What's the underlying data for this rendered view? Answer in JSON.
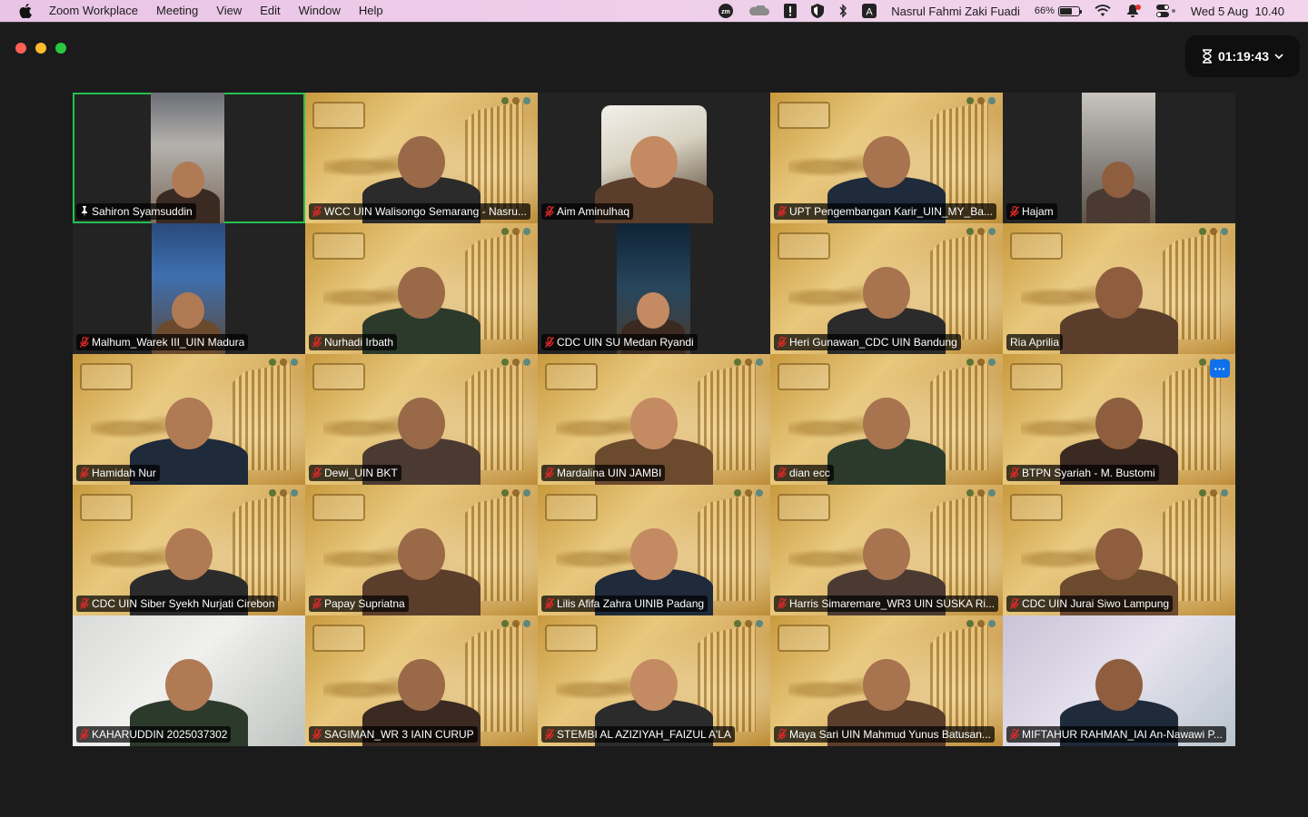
{
  "menubar": {
    "app_name": "Zoom Workplace",
    "menus": [
      "Meeting",
      "View",
      "Edit",
      "Window",
      "Help"
    ],
    "user_name": "Nasrul Fahmi Zaki Fuadi",
    "battery": "66%",
    "battery_level": 0.66,
    "datetime": "Wed 5 Aug  10.40",
    "zoom_icon_text": "zm",
    "input_source": "A"
  },
  "meeting": {
    "timer": "01:19:43"
  },
  "participants": [
    {
      "name": "Sahiron Syamsuddin",
      "muted": false,
      "pinned": true,
      "video": "strip-grey",
      "active": true
    },
    {
      "name": "WCC UIN Walisongo Semarang - Nasru...",
      "muted": true,
      "video": "gold"
    },
    {
      "name": "Aim Aminulhaq",
      "muted": true,
      "video": "round"
    },
    {
      "name": "UPT Pengembangan Karir_UIN_MY_Ba...",
      "muted": true,
      "video": "gold"
    },
    {
      "name": "Hajam",
      "muted": true,
      "video": "strip-light"
    },
    {
      "name": "Malhum_Warek III_UIN Madura",
      "muted": true,
      "video": "strip-blue"
    },
    {
      "name": "Nurhadi Irbath",
      "muted": true,
      "video": "gold"
    },
    {
      "name": "CDC UIN SU Medan Ryandi",
      "muted": true,
      "video": "strip-dark"
    },
    {
      "name": "Heri Gunawan_CDC UIN Bandung",
      "muted": true,
      "video": "gold"
    },
    {
      "name": "Ria Aprilia",
      "muted": false,
      "video": "gold"
    },
    {
      "name": "Hamidah Nur",
      "muted": true,
      "video": "gold"
    },
    {
      "name": "Dewi_UIN BKT",
      "muted": true,
      "video": "gold"
    },
    {
      "name": "Mardalina UIN JAMBI",
      "muted": true,
      "video": "gold"
    },
    {
      "name": "dian ecc",
      "muted": true,
      "video": "gold"
    },
    {
      "name": "BTPN Syariah - M. Bustomi",
      "muted": true,
      "video": "gold",
      "more": true
    },
    {
      "name": "CDC UIN Siber Syekh Nurjati Cirebon",
      "muted": true,
      "video": "gold"
    },
    {
      "name": "Papay Supriatna",
      "muted": true,
      "video": "gold"
    },
    {
      "name": "Lilis Afifa Zahra UINIB Padang",
      "muted": true,
      "video": "gold"
    },
    {
      "name": "Harris Simaremare_WR3 UIN SUSKA Ri...",
      "muted": true,
      "video": "gold"
    },
    {
      "name": "CDC UIN Jurai Siwo Lampung",
      "muted": true,
      "video": "gold"
    },
    {
      "name": "KAHARUDDIN 2025037302",
      "muted": true,
      "video": "room"
    },
    {
      "name": "SAGIMAN_WR 3 IAIN CURUP",
      "muted": true,
      "video": "gold"
    },
    {
      "name": "STEMBI AL AZIZIYAH_FAIZUL A'LA",
      "muted": true,
      "video": "gold"
    },
    {
      "name": "Maya Sari UIN Mahmud Yunus Batusan...",
      "muted": true,
      "video": "gold"
    },
    {
      "name": "MIFTAHUR RAHMAN_IAI An-Nawawi P...",
      "muted": true,
      "video": "light"
    }
  ],
  "colors": {
    "active_speaker_border": "#25c050",
    "more_button": "#0e71eb",
    "muted_mic": "#e02828"
  }
}
